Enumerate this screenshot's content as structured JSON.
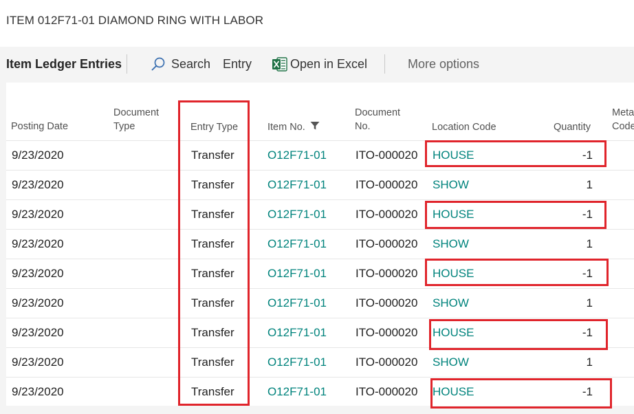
{
  "page": {
    "title": "ITEM 012F71-01 DIAMOND RING WITH LABOR"
  },
  "toolbar": {
    "title": "Item Ledger Entries",
    "search_label": "Search",
    "entry_label": "Entry",
    "excel_label": "Open in Excel",
    "more_label": "More options"
  },
  "table": {
    "headers": {
      "posting_date": "Posting Date",
      "document_type_1": "Document",
      "document_type_2": "Type",
      "entry_type": "Entry Type",
      "item_no": "Item No.",
      "document_no_1": "Document",
      "document_no_2": "No.",
      "location_code": "Location Code",
      "quantity": "Quantity",
      "meta_1": "Meta",
      "meta_2": "Code"
    },
    "rows": [
      {
        "posting_date": "9/23/2020",
        "entry_type": "Transfer",
        "item_no": "O12F71-01",
        "document_no": "ITO-000020",
        "location_code": "HOUSE",
        "quantity": "-1"
      },
      {
        "posting_date": "9/23/2020",
        "entry_type": "Transfer",
        "item_no": "O12F71-01",
        "document_no": "ITO-000020",
        "location_code": "SHOW",
        "quantity": "1"
      },
      {
        "posting_date": "9/23/2020",
        "entry_type": "Transfer",
        "item_no": "O12F71-01",
        "document_no": "ITO-000020",
        "location_code": "HOUSE",
        "quantity": "-1"
      },
      {
        "posting_date": "9/23/2020",
        "entry_type": "Transfer",
        "item_no": "O12F71-01",
        "document_no": "ITO-000020",
        "location_code": "SHOW",
        "quantity": "1"
      },
      {
        "posting_date": "9/23/2020",
        "entry_type": "Transfer",
        "item_no": "O12F71-01",
        "document_no": "ITO-000020",
        "location_code": "HOUSE",
        "quantity": "-1"
      },
      {
        "posting_date": "9/23/2020",
        "entry_type": "Transfer",
        "item_no": "O12F71-01",
        "document_no": "ITO-000020",
        "location_code": "SHOW",
        "quantity": "1"
      },
      {
        "posting_date": "9/23/2020",
        "entry_type": "Transfer",
        "item_no": "O12F71-01",
        "document_no": "ITO-000020",
        "location_code": "HOUSE",
        "quantity": "-1"
      },
      {
        "posting_date": "9/23/2020",
        "entry_type": "Transfer",
        "item_no": "O12F71-01",
        "document_no": "ITO-000020",
        "location_code": "SHOW",
        "quantity": "1"
      },
      {
        "posting_date": "9/23/2020",
        "entry_type": "Transfer",
        "item_no": "O12F71-01",
        "document_no": "ITO-000020",
        "location_code": "HOUSE",
        "quantity": "-1"
      }
    ]
  },
  "colors": {
    "link": "#00837c",
    "highlight": "#e0242b",
    "excel": "#1e7145"
  },
  "icons": {
    "search": "search-icon",
    "excel": "excel-icon",
    "filter": "filter-icon"
  }
}
